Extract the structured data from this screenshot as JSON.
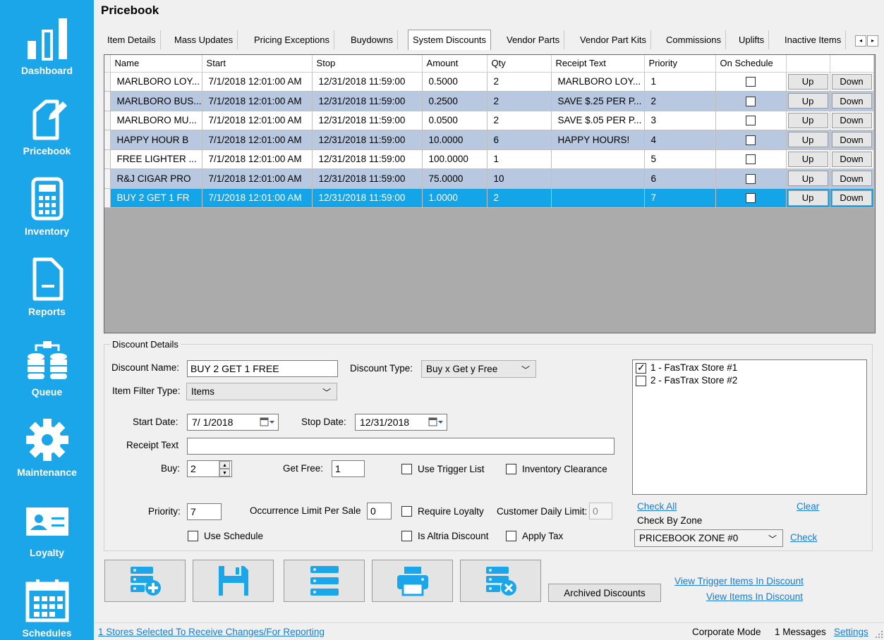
{
  "sidebar": {
    "items": [
      {
        "label": "Dashboard",
        "icon": "bar-chart-icon"
      },
      {
        "label": "Pricebook",
        "icon": "tag-edit-icon"
      },
      {
        "label": "Inventory",
        "icon": "calculator-icon"
      },
      {
        "label": "Reports",
        "icon": "document-icon"
      },
      {
        "label": "Queue",
        "icon": "database-sync-icon"
      },
      {
        "label": "Maintenance",
        "icon": "gear-icon"
      },
      {
        "label": "Loyalty",
        "icon": "id-card-icon"
      },
      {
        "label": "Schedules",
        "icon": "calendar-icon"
      }
    ]
  },
  "header": {
    "title": "Pricebook"
  },
  "tabs": [
    {
      "label": "Item Details"
    },
    {
      "label": "Mass Updates"
    },
    {
      "label": "Pricing Exceptions"
    },
    {
      "label": "Buydowns"
    },
    {
      "label": "System Discounts",
      "active": true
    },
    {
      "label": "Vendor Parts"
    },
    {
      "label": "Vendor Part Kits"
    },
    {
      "label": "Commissions"
    },
    {
      "label": "Uplifts"
    },
    {
      "label": "Inactive Items"
    }
  ],
  "tab_scroll": {
    "left": "◂",
    "right": "▸"
  },
  "grid": {
    "columns": [
      "Name",
      "Start",
      "Stop",
      "Amount",
      "Qty",
      "Receipt Text",
      "Priority",
      "On Schedule",
      "",
      ""
    ],
    "up_label": "Up",
    "down_label": "Down",
    "rows": [
      {
        "name": "MARLBORO LOY...",
        "start": "7/1/2018 12:01:00 AM",
        "stop": "12/31/2018 11:59:00",
        "amount": "0.5000",
        "qty": "2",
        "receipt": "MARLBORO LOY...",
        "priority": "1"
      },
      {
        "name": "MARLBORO BUS...",
        "start": "7/1/2018 12:01:00 AM",
        "stop": "12/31/2018 11:59:00",
        "amount": "0.2500",
        "qty": "2",
        "receipt": "SAVE $.25 PER P...",
        "priority": "2"
      },
      {
        "name": "MARLBORO MU...",
        "start": "7/1/2018 12:01:00 AM",
        "stop": "12/31/2018 11:59:00",
        "amount": "0.0500",
        "qty": "2",
        "receipt": "SAVE $.05 PER P...",
        "priority": "3"
      },
      {
        "name": "HAPPY HOUR B",
        "start": "7/1/2018 12:01:00 AM",
        "stop": "12/31/2018 11:59:00",
        "amount": "10.0000",
        "qty": "6",
        "receipt": "HAPPY HOURS!",
        "priority": "4"
      },
      {
        "name": "FREE LIGHTER ...",
        "start": "7/1/2018 12:01:00 AM",
        "stop": "12/31/2018 11:59:00",
        "amount": "100.0000",
        "qty": "1",
        "receipt": "",
        "priority": "5"
      },
      {
        "name": "R&J CIGAR PRO",
        "start": "7/1/2018 12:01:00 AM",
        "stop": "12/31/2018 11:59:00",
        "amount": "75.0000",
        "qty": "10",
        "receipt": "",
        "priority": "6"
      },
      {
        "name": "BUY 2 GET 1 FR",
        "start": "7/1/2018 12:01:00 AM",
        "stop": "12/31/2018 11:59:00",
        "amount": "1.0000",
        "qty": "2",
        "receipt": "",
        "priority": "7"
      }
    ]
  },
  "details": {
    "legend": "Discount Details",
    "discount_name_label": "Discount Name:",
    "discount_name_value": "BUY 2 GET 1 FREE",
    "discount_type_label": "Discount Type:",
    "discount_type_value": "Buy x Get y Free",
    "item_filter_label": "Item Filter Type:",
    "item_filter_value": "Items",
    "start_date_label": "Start Date:",
    "start_date_value": "7/ 1/2018",
    "stop_date_label": "Stop Date:",
    "stop_date_value": "12/31/2018",
    "receipt_text_label": "Receipt Text",
    "receipt_text_value": "",
    "buy_label": "Buy:",
    "buy_value": "2",
    "get_free_label": "Get Free:",
    "get_free_value": "1",
    "use_trigger_label": "Use Trigger List",
    "inventory_clearance_label": "Inventory Clearance",
    "priority_label": "Priority:",
    "priority_value": "7",
    "occurrence_label": "Occurrence Limit Per Sale",
    "occurrence_value": "0",
    "require_loyalty_label": "Require Loyalty",
    "customer_daily_label": "Customer Daily Limit:",
    "customer_daily_value": "0",
    "use_schedule_label": "Use Schedule",
    "altria_label": "Is Altria Discount",
    "apply_tax_label": "Apply Tax"
  },
  "stores": {
    "items": [
      {
        "label": "1 - FasTrax Store #1",
        "checked": true
      },
      {
        "label": "2 - FasTrax Store #2",
        "checked": false
      }
    ],
    "check_all": "Check All",
    "clear": "Clear",
    "check_by_zone": "Check By Zone",
    "zone_value": "PRICEBOOK ZONE #0",
    "check": "Check"
  },
  "actions": {
    "archived": "Archived Discounts",
    "view_trigger": "View Trigger Items In Discount",
    "view_items": "View Items In Discount",
    "buttons": [
      "add-discount-icon",
      "save-icon",
      "list-icon",
      "print-icon",
      "delete-discount-icon"
    ]
  },
  "status": {
    "stores_selected": "1 Stores Selected To Receive Changes/For Reporting",
    "mode": "Corporate Mode",
    "messages": "1 Messages",
    "settings": "Settings"
  },
  "colors": {
    "sidebar": "#1aa6e8",
    "selected_row": "#14a4e8",
    "alt_row": "#b8c8e0",
    "link": "#1a7bd0"
  }
}
